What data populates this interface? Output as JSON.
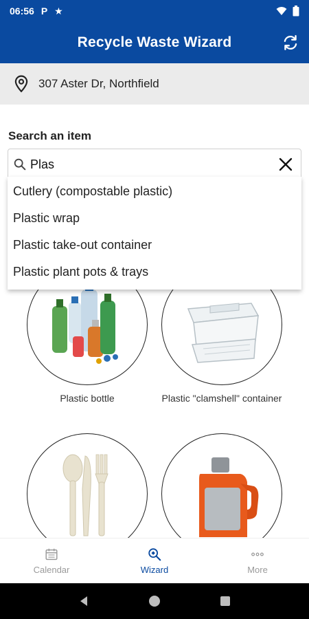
{
  "status_bar": {
    "time": "06:56",
    "icons": [
      "parking-icon",
      "star-icon",
      "wifi-icon",
      "battery-icon"
    ]
  },
  "app_bar": {
    "title": "Recycle Waste Wizard",
    "action_icon": "refresh-icon"
  },
  "address": {
    "text": "307 Aster Dr, Northfield",
    "icon": "location-pin-icon"
  },
  "search": {
    "label": "Search an item",
    "value": "Plas",
    "suggestions": [
      "Cutlery (compostable plastic)",
      "Plastic wrap",
      "Plastic take-out container",
      "Plastic plant pots & trays"
    ]
  },
  "items": [
    {
      "caption": "Plastic bottle"
    },
    {
      "caption": "Plastic \"clamshell\" container"
    },
    {
      "caption": ""
    },
    {
      "caption": ""
    }
  ],
  "bottom_nav": [
    {
      "label": "Calendar",
      "icon": "calendar-icon",
      "active": false
    },
    {
      "label": "Wizard",
      "icon": "wizard-search-icon",
      "active": true
    },
    {
      "label": "More",
      "icon": "more-dots-icon",
      "active": false
    }
  ],
  "colors": {
    "primary": "#0a4aa0",
    "address_bg": "#ebebeb",
    "nav_inactive": "#9a9a9a"
  }
}
